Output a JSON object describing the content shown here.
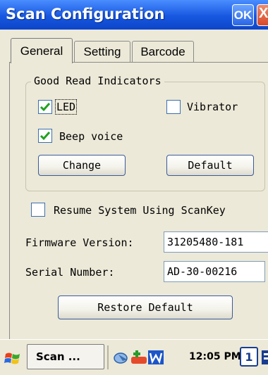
{
  "window": {
    "title": "Scan Configuration",
    "ok_label": "OK",
    "close_label": "X"
  },
  "tabs": [
    {
      "label": "General",
      "active": true
    },
    {
      "label": "Setting",
      "active": false
    },
    {
      "label": "Barcode",
      "active": false
    }
  ],
  "good_read": {
    "title": "Good Read Indicators",
    "led": {
      "label": "LED",
      "checked": true
    },
    "vibrator": {
      "label": "Vibrator",
      "checked": false
    },
    "beep": {
      "label": "Beep voice",
      "checked": true
    },
    "change_label": "Change",
    "default_label": "Default"
  },
  "resume": {
    "label": "Resume System Using ScanKey",
    "checked": false
  },
  "firmware": {
    "label": "Firmware Version:",
    "value": "31205480-181"
  },
  "serial": {
    "label": "Serial Number:",
    "value": "AD-30-00216"
  },
  "restore_label": "Restore Default",
  "taskbar": {
    "task_label": "Scan ...",
    "time": "12:05 PM",
    "keyboard_label": "1"
  },
  "colors": {
    "titlebar": "#1757e0",
    "dialog_bg": "#ece9d8",
    "check": "#21a121"
  }
}
